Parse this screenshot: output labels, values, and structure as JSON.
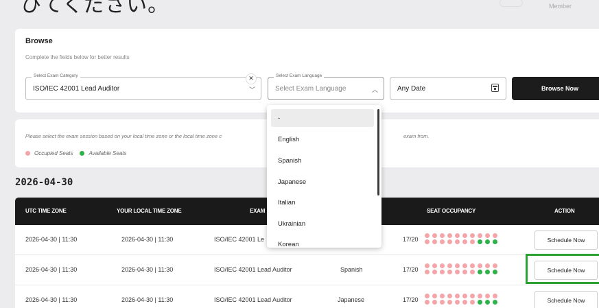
{
  "banner": {
    "jp_text": "ひてください。",
    "member_label": "Member"
  },
  "browse": {
    "title": "Browse",
    "subtitle": "Complete the fields below for better results",
    "category_label": "Select Exam Category",
    "category_value": "ISO/IEC 42001 Lead Auditor",
    "clear_symbol": "✕",
    "language_label": "Select Exam Language",
    "language_placeholder": "Select Exam Language",
    "date_placeholder": "Any Date",
    "browse_button": "Browse Now"
  },
  "info": {
    "text_left": "Please select the exam session based on your local time zone or the local time zone c",
    "text_right": "exam from.",
    "legend_occupied": "Occupied Seats",
    "legend_available": "Available Seats"
  },
  "date_heading": "2026-04-30",
  "table": {
    "headers": [
      "UTC TIME ZONE",
      "YOUR LOCAL TIME ZONE",
      "EXAM",
      "SEAT OCCUPANCY",
      "ACTION"
    ],
    "rows": [
      {
        "utc": "2026-04-30 | 11:30",
        "local": "2026-04-30 | 11:30",
        "exam": "ISO/IEC 42001 Le",
        "language": "",
        "occupancy": "17/20",
        "action": "Schedule Now"
      },
      {
        "utc": "2026-04-30 | 11:30",
        "local": "2026-04-30 | 11:30",
        "exam": "ISO/IEC 42001 Lead Auditor",
        "language": "Spanish",
        "occupancy": "17/20",
        "action": "Schedule Now"
      },
      {
        "utc": "2026-04-30 | 11:30",
        "local": "2026-04-30 | 11:30",
        "exam": "ISO/IEC 42001 Lead Auditor",
        "language": "Japanese",
        "occupancy": "17/20",
        "action": "Schedule Now"
      }
    ],
    "seats_occupied": 17,
    "seats_total": 20
  },
  "dropdown": {
    "options": [
      "-",
      "English",
      "Spanish",
      "Japanese",
      "Italian",
      "Ukrainian",
      "Korean"
    ]
  },
  "colors": {
    "occupied": "#f4a5aa",
    "available": "#2fb24a",
    "highlight": "#2da234",
    "header_bg": "#1a1a1a"
  }
}
